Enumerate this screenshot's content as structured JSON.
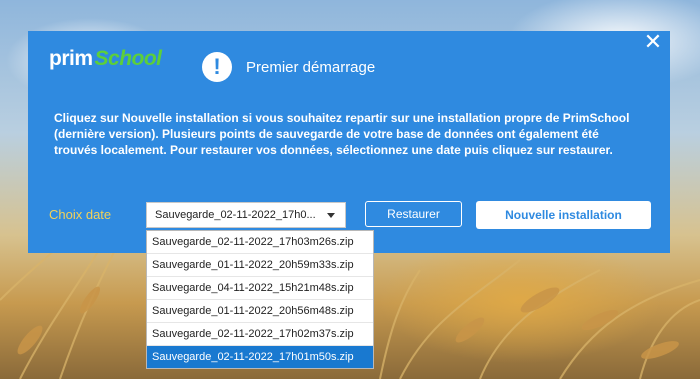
{
  "dialog": {
    "logo_prim": "prim",
    "logo_school": "School",
    "close_icon": "close-icon",
    "info_icon_glyph": "!",
    "title": "Premier démarrage",
    "message": "Cliquez sur Nouvelle installation si vous souhaitez repartir sur une installation propre de PrimSchool (dernière version). Plusieurs points de sauvegarde de votre base de données ont également été trouvés localement. Pour restaurer vos données, sélectionnez une date puis cliquez sur restaurer.",
    "choix_label": "Choix date",
    "select_value": "Sauvegarde_02-11-2022_17h0...",
    "restore_label": "Restaurer",
    "new_install_label": "Nouvelle installation",
    "colors": {
      "dialog_bg": "#2f8ae0",
      "label_yellow": "#f2d25a",
      "logo_green": "#5ccf3a",
      "selected_bg": "#1979d0"
    }
  },
  "dropdown": {
    "options": [
      "Sauvegarde_02-11-2022_17h03m26s.zip",
      "Sauvegarde_01-11-2022_20h59m33s.zip",
      "Sauvegarde_04-11-2022_15h21m48s.zip",
      "Sauvegarde_01-11-2022_20h56m48s.zip",
      "Sauvegarde_02-11-2022_17h02m37s.zip",
      "Sauvegarde_02-11-2022_17h01m50s.zip"
    ],
    "selected_index": 5
  }
}
